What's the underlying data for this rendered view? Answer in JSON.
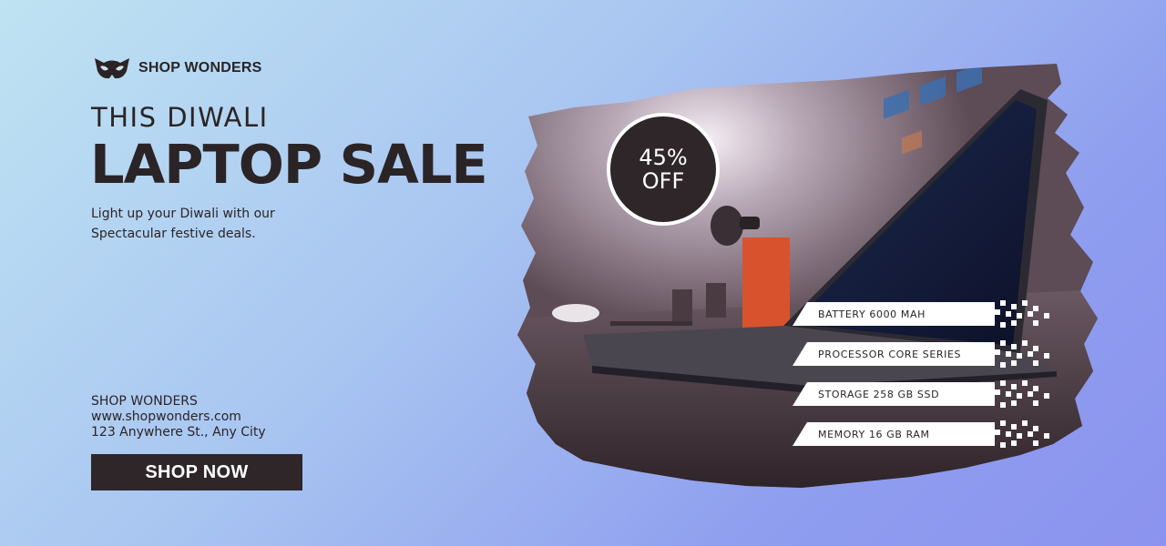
{
  "brand": {
    "name": "SHOP WONDERS",
    "logo_icon": "owl-mask-icon"
  },
  "headline": {
    "eyebrow": "THIS DIWALI",
    "title": "LAPTOP SALE"
  },
  "tagline": {
    "line1": "Light up your Diwali with our",
    "line2": "Spectacular festive deals."
  },
  "discount": {
    "percent": "45%",
    "label": "OFF"
  },
  "specs": [
    {
      "label": "BATTERY 6000 MAH"
    },
    {
      "label": "PROCESSOR CORE SERIES"
    },
    {
      "label": "STORAGE 258 GB SSD"
    },
    {
      "label": "MEMORY 16 GB RAM"
    }
  ],
  "contact": {
    "company": "SHOP WONDERS",
    "website": "www.shopwonders.com",
    "address": "123 Anywhere St., Any City"
  },
  "cta": {
    "label": "SHOP NOW"
  },
  "colors": {
    "dark": "#2f2629",
    "bg_start": "#bfe3f2",
    "bg_end": "#8b93ee",
    "white": "#ffffff"
  }
}
